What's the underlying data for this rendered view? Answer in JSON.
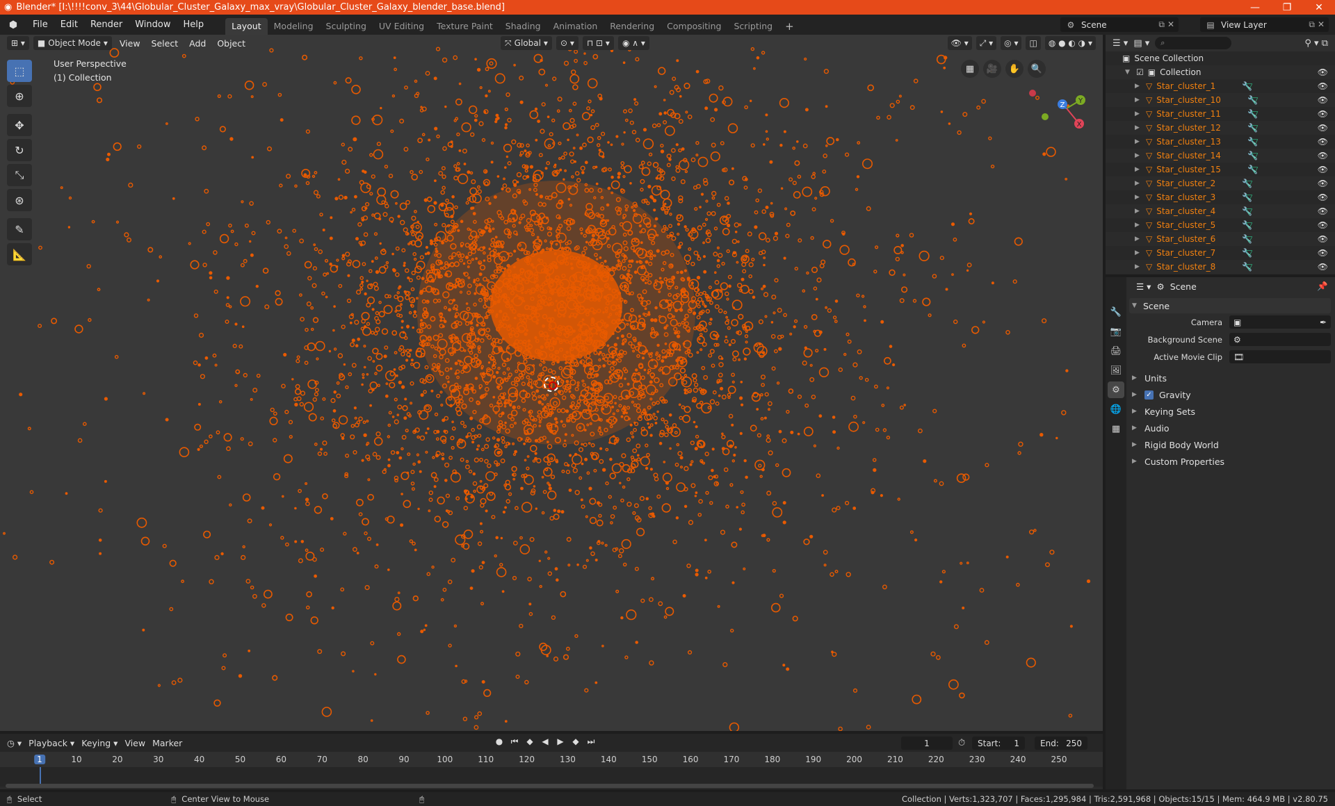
{
  "window": {
    "title": "Blender* [I:\\!!!!conv_3\\44\\Globular_Cluster_Galaxy_max_vray\\Globular_Cluster_Galaxy_blender_base.blend]",
    "controls": [
      "—",
      "❐",
      "✕"
    ]
  },
  "menu": [
    "File",
    "Edit",
    "Render",
    "Window",
    "Help"
  ],
  "workspaces": [
    "Layout",
    "Modeling",
    "Sculpting",
    "UV Editing",
    "Texture Paint",
    "Shading",
    "Animation",
    "Rendering",
    "Compositing",
    "Scripting"
  ],
  "active_workspace": "Layout",
  "scene_selector": "Scene",
  "view_layer_selector": "View Layer",
  "viewport": {
    "mode": "Object Mode",
    "menus": [
      "View",
      "Select",
      "Add",
      "Object"
    ],
    "orientation": "Global",
    "perspective_label": "User Perspective",
    "collection_label": "(1) Collection",
    "star_color": "#e85a00",
    "background": "#393939",
    "gizmo_axes": [
      "X",
      "Y",
      "Z"
    ]
  },
  "outliner": {
    "search_placeholder": "",
    "root": "Scene Collection",
    "collection": "Collection",
    "objects": [
      "Star_cluster_1",
      "Star_cluster_10",
      "Star_cluster_11",
      "Star_cluster_12",
      "Star_cluster_13",
      "Star_cluster_14",
      "Star_cluster_15",
      "Star_cluster_2",
      "Star_cluster_3",
      "Star_cluster_4",
      "Star_cluster_5",
      "Star_cluster_6",
      "Star_cluster_7",
      "Star_cluster_8"
    ]
  },
  "properties": {
    "header": "Scene",
    "panel": "Scene",
    "camera_label": "Camera",
    "background_scene_label": "Background Scene",
    "active_movie_clip_label": "Active Movie Clip",
    "subpanels": [
      "Units",
      "Gravity",
      "Keying Sets",
      "Audio",
      "Rigid Body World",
      "Custom Properties"
    ],
    "gravity_checked": true
  },
  "timeline": {
    "menus": [
      "Playback",
      "Keying",
      "View",
      "Marker"
    ],
    "current_frame": "1",
    "start_label": "Start:",
    "start": "1",
    "end_label": "End:",
    "end": "250",
    "ruler": [
      "1",
      "10",
      "20",
      "30",
      "40",
      "50",
      "60",
      "70",
      "80",
      "90",
      "100",
      "110",
      "120",
      "130",
      "140",
      "150",
      "160",
      "170",
      "180",
      "190",
      "200",
      "210",
      "220",
      "230",
      "240",
      "250"
    ]
  },
  "statusbar": {
    "select": "Select",
    "center": "Center View to Mouse",
    "stats": "Collection | Verts:1,323,707 | Faces:1,295,984 | Tris:2,591,968 | Objects:15/15 | Mem: 464.9 MB | v2.80.75"
  }
}
